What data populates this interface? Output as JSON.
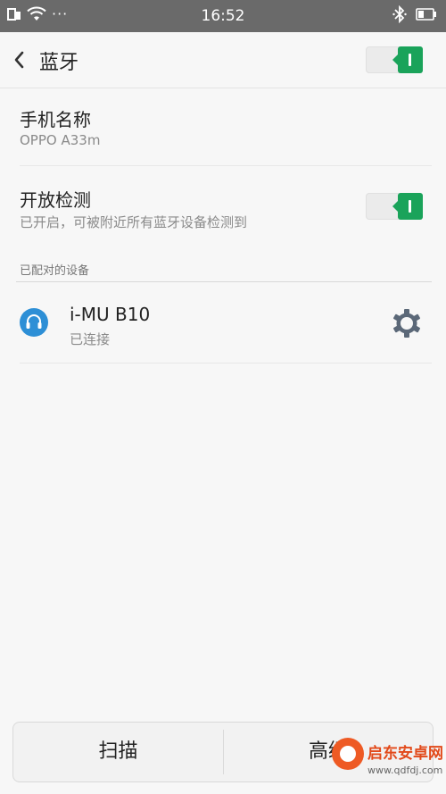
{
  "status_bar": {
    "time": "16:52",
    "dots": "···"
  },
  "header": {
    "title": "蓝牙",
    "bluetooth_enabled": true
  },
  "phone_name": {
    "label": "手机名称",
    "value": "OPPO A33m"
  },
  "visibility": {
    "label": "开放检测",
    "description": "已开启，可被附近所有蓝牙设备检测到",
    "enabled": true
  },
  "paired_section": {
    "label": "已配对的设备",
    "devices": [
      {
        "name": "i-MU B10",
        "status": "已连接",
        "icon": "headset-icon"
      }
    ]
  },
  "bottom_bar": {
    "scan_label": "扫描",
    "advanced_label": "高级"
  },
  "watermark": {
    "name": "启东安卓网",
    "url": "www.qdfdj.com"
  },
  "colors": {
    "accent_green": "#1aa35a",
    "device_blue": "#2d8fd6",
    "status_bar": "#6a6a6a"
  }
}
